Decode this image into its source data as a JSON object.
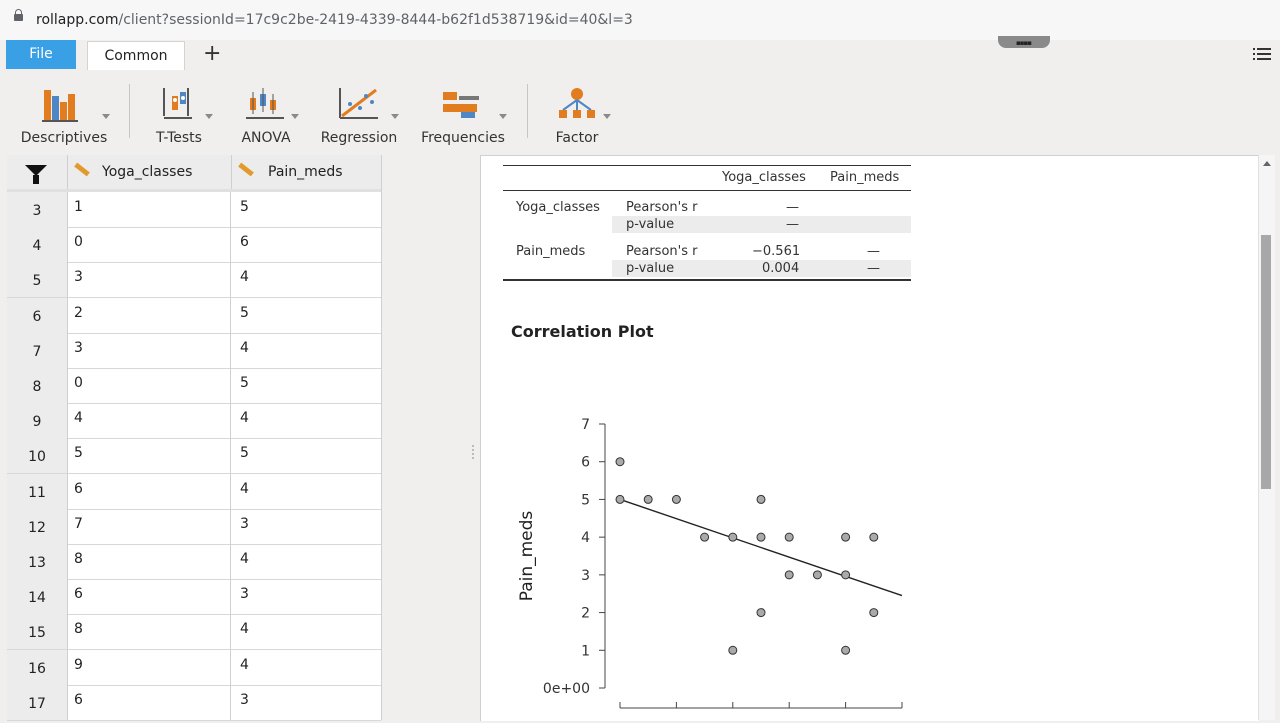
{
  "browser": {
    "url_host": "rollapp.com",
    "url_path": "/client?sessionId=17c9c2be-2419-4339-8444-b62f1d538719&id=40&l=3"
  },
  "tabs": {
    "file": "File",
    "common": "Common",
    "add": "+"
  },
  "ribbon": [
    {
      "label": "Descriptives",
      "icon": "bar-chart-icon"
    },
    {
      "label": "T-Tests",
      "icon": "ttest-icon"
    },
    {
      "label": "ANOVA",
      "icon": "anova-icon"
    },
    {
      "label": "Regression",
      "icon": "regression-icon"
    },
    {
      "label": "Frequencies",
      "icon": "frequencies-icon"
    },
    {
      "label": "Factor",
      "icon": "factor-icon"
    }
  ],
  "grid": {
    "columns": [
      "Yoga_classes",
      "Pain_meds"
    ],
    "rows": [
      {
        "n": "3",
        "yoga": "1",
        "pain": "5"
      },
      {
        "n": "4",
        "yoga": "0",
        "pain": "6"
      },
      {
        "n": "5",
        "yoga": "3",
        "pain": "4"
      },
      {
        "n": "6",
        "yoga": "2",
        "pain": "5"
      },
      {
        "n": "7",
        "yoga": "3",
        "pain": "4"
      },
      {
        "n": "8",
        "yoga": "0",
        "pain": "5"
      },
      {
        "n": "9",
        "yoga": "4",
        "pain": "4"
      },
      {
        "n": "10",
        "yoga": "5",
        "pain": "5"
      },
      {
        "n": "11",
        "yoga": "6",
        "pain": "4"
      },
      {
        "n": "12",
        "yoga": "7",
        "pain": "3"
      },
      {
        "n": "13",
        "yoga": "8",
        "pain": "4"
      },
      {
        "n": "14",
        "yoga": "6",
        "pain": "3"
      },
      {
        "n": "15",
        "yoga": "8",
        "pain": "4"
      },
      {
        "n": "16",
        "yoga": "9",
        "pain": "4"
      },
      {
        "n": "17",
        "yoga": "6",
        "pain": "3"
      }
    ]
  },
  "corr_table": {
    "col1": "Yoga_classes",
    "col2": "Pain_meds",
    "row1_var": "Yoga_classes",
    "row2_var": "Pain_meds",
    "pearson": "Pearson's r",
    "pvalue": "p-value",
    "r1_r": "—",
    "r1_p": "—",
    "r2_r": "−0.561",
    "r2_r2": "—",
    "r2_p": "0.004",
    "r2_p2": "—"
  },
  "plot": {
    "title": "Correlation Plot"
  },
  "chart_data": {
    "type": "scatter",
    "ylabel": "Pain_meds",
    "xlabel": "",
    "y_ticks": [
      "0e+00",
      "1",
      "2",
      "3",
      "4",
      "5",
      "6",
      "7"
    ],
    "ylim": [
      0,
      7
    ],
    "xlim": [
      0,
      10
    ],
    "points": [
      [
        0,
        6
      ],
      [
        0,
        5
      ],
      [
        1,
        5
      ],
      [
        2,
        5
      ],
      [
        3,
        4
      ],
      [
        4,
        4
      ],
      [
        4,
        1
      ],
      [
        5,
        5
      ],
      [
        5,
        4
      ],
      [
        5,
        2
      ],
      [
        6,
        4
      ],
      [
        6,
        3
      ],
      [
        7,
        3
      ],
      [
        8,
        4
      ],
      [
        8,
        3
      ],
      [
        8,
        1
      ],
      [
        9,
        4
      ],
      [
        9,
        2
      ]
    ],
    "trendline": [
      [
        0,
        5
      ],
      [
        10,
        2.45
      ]
    ]
  }
}
